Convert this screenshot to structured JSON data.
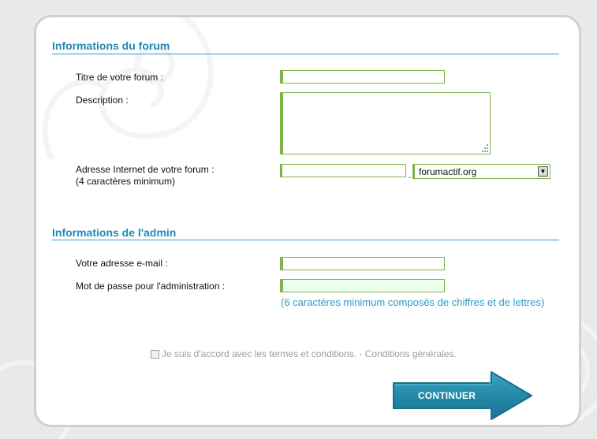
{
  "forum_section": {
    "title": "Informations du forum",
    "title_label": "Titre de votre forum :",
    "description_label": "Description :",
    "address_label_line1": "Adresse Internet de votre forum :",
    "address_label_line2": "(4 caractères minimum)",
    "address_separator": ".",
    "domain_selected": "forumactif.org"
  },
  "admin_section": {
    "title": "Informations de l'admin",
    "email_label": "Votre adresse e-mail :",
    "password_label": "Mot de passe pour l'administration :",
    "password_hint": "(6 caractères minimum composés de chiffres et de lettres)"
  },
  "terms": {
    "text": "Je suis d'accord avec les termes et conditions. - Conditions générales."
  },
  "continue_button": {
    "label": "CONTINUER"
  },
  "colors": {
    "accent_blue": "#2a9cc6",
    "field_green": "#7fb34a",
    "button_teal": "#2489a8"
  }
}
